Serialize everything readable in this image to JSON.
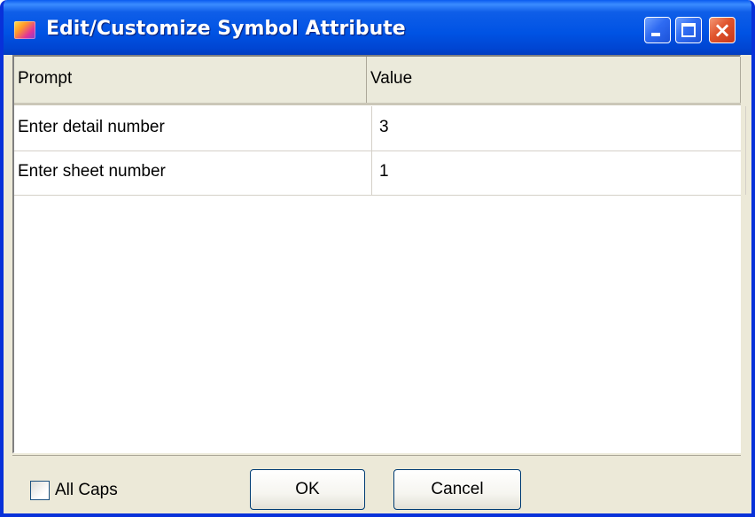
{
  "window": {
    "title": "Edit/Customize Symbol Attribute",
    "icon": "app-icon",
    "controls": {
      "minimize": "minimize-icon",
      "maximize": "maximize-icon",
      "close": "×"
    }
  },
  "grid": {
    "headers": [
      "Prompt",
      "Value"
    ],
    "rows": [
      {
        "prompt": "Enter detail number",
        "value": "3"
      },
      {
        "prompt": "Enter sheet number",
        "value": "1"
      }
    ]
  },
  "footer": {
    "all_caps_label": "All Caps",
    "all_caps_checked": false,
    "ok_label": "OK",
    "cancel_label": "Cancel"
  },
  "colors": {
    "titlebar": "#0054e3",
    "frame": "#0831d9",
    "dialog_bg": "#ece9d8",
    "close_button": "#e0542c"
  }
}
